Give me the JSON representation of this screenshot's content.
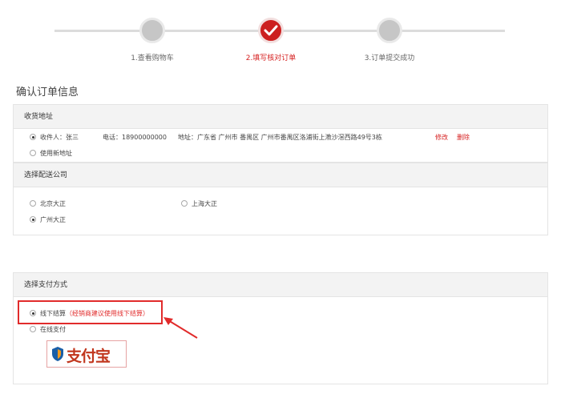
{
  "steps": [
    {
      "label": "1.查看购物车"
    },
    {
      "label": "2.填写核对订单"
    },
    {
      "label": "3.订单提交成功"
    }
  ],
  "page_title": "确认订单信息",
  "address": {
    "heading": "收货地址",
    "receiver": "收件人：张三",
    "phone": "电话：18900000000",
    "detail": "地址：广东省 广州市 番禺区 广州市番禺区洛浦街上漖沙滘西路49号3栋",
    "edit": "修改",
    "delete": "删除",
    "new_address": "使用新地址"
  },
  "delivery": {
    "heading": "选择配送公司",
    "options": [
      "北京大正",
      "上海大正",
      "广州大正"
    ]
  },
  "payment": {
    "heading": "选择支付方式",
    "offline": "线下结算",
    "offline_hint": "（经销商建议使用线下结算）",
    "online": "在线支付",
    "alipay_logo": "支付宝"
  },
  "colors": {
    "accent": "#d62222",
    "border": "#e4e4e4",
    "header_bg": "#f3f3f3"
  }
}
